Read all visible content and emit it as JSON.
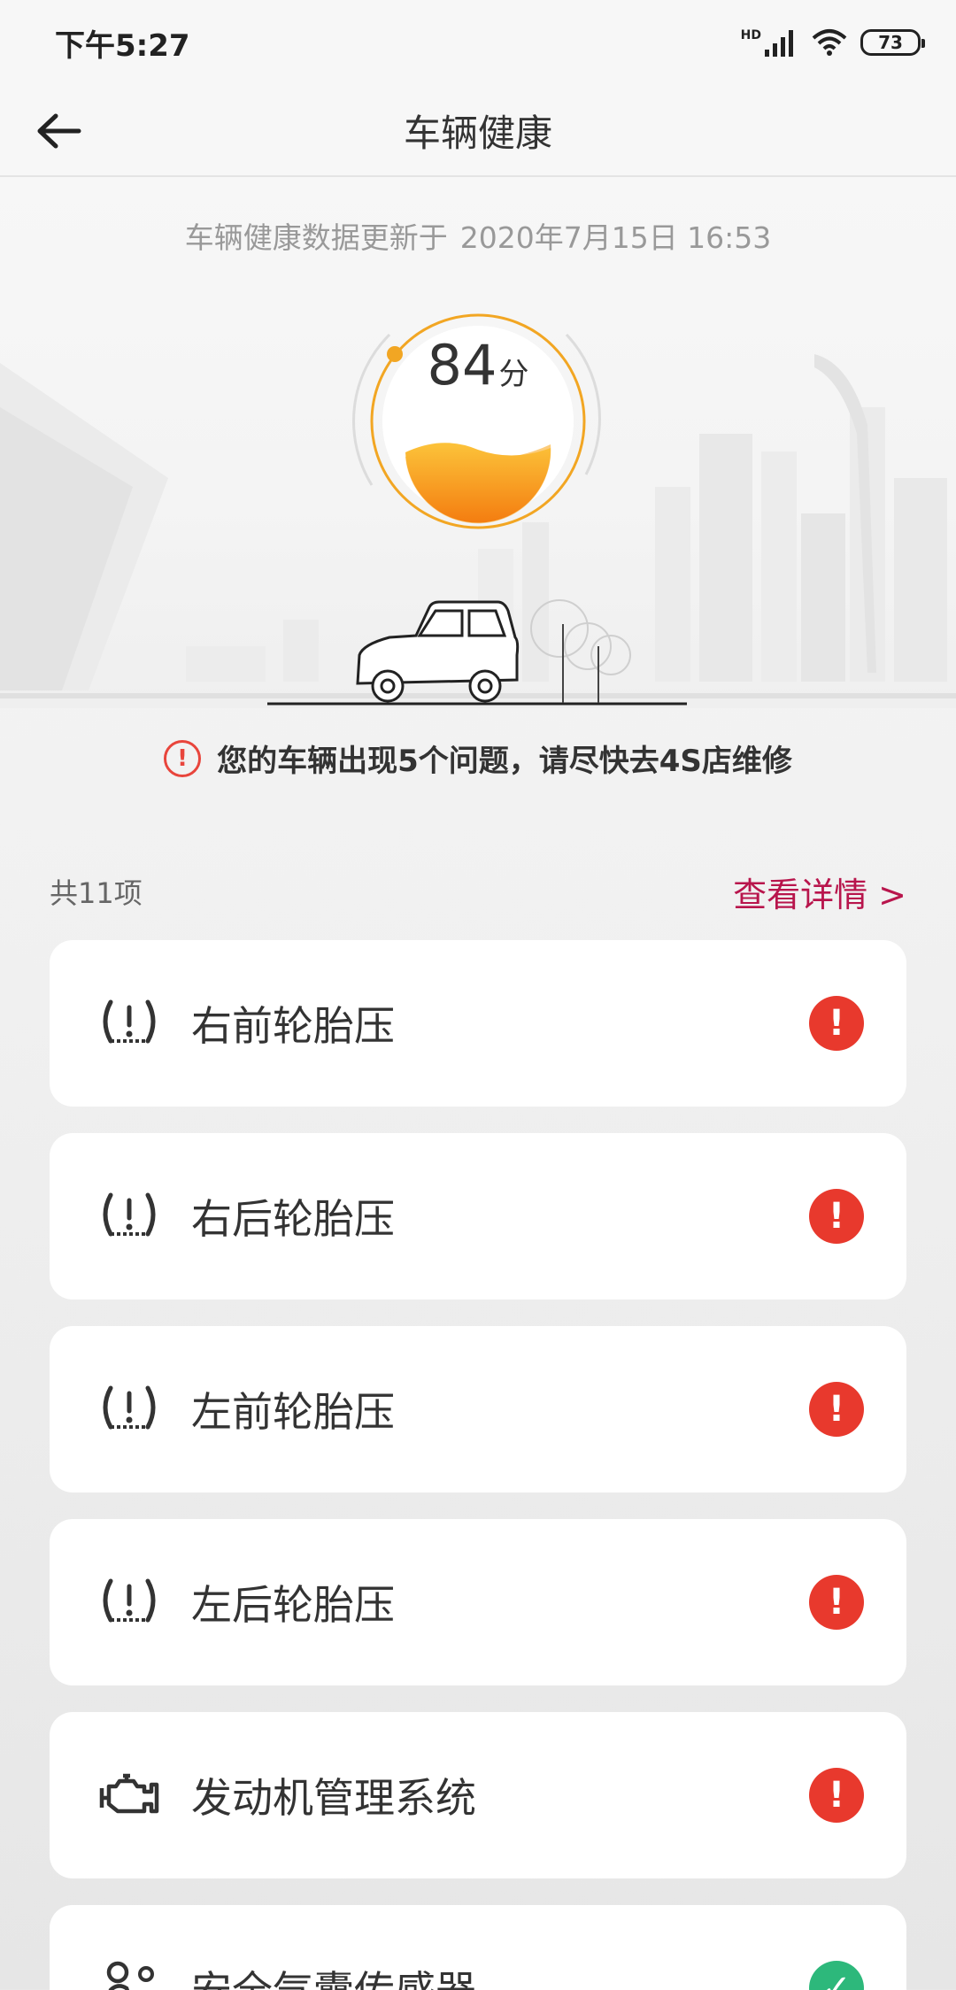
{
  "status_bar": {
    "time": "下午5:27",
    "network": "HD",
    "battery": "73"
  },
  "app_bar": {
    "title": "车辆健康",
    "back_icon": "arrow-left-icon"
  },
  "health": {
    "update_label": "车辆健康数据更新于",
    "update_time": "2020年7月15日 16:53",
    "score": "84",
    "score_unit": "分",
    "score_value": 84,
    "accent_color": "#f2a623"
  },
  "alert": {
    "icon": "!",
    "message": "您的车辆出现5个问题，请尽快去4S店维修",
    "color": "#e8453c"
  },
  "list": {
    "count_label": "共11项",
    "details_link": "查看详情 >",
    "items": [
      {
        "label": "右前轮胎压",
        "icon": "tire-pressure-icon",
        "status": "error",
        "status_glyph": "!"
      },
      {
        "label": "右后轮胎压",
        "icon": "tire-pressure-icon",
        "status": "error",
        "status_glyph": "!"
      },
      {
        "label": "左前轮胎压",
        "icon": "tire-pressure-icon",
        "status": "error",
        "status_glyph": "!"
      },
      {
        "label": "左后轮胎压",
        "icon": "tire-pressure-icon",
        "status": "error",
        "status_glyph": "!"
      },
      {
        "label": "发动机管理系统",
        "icon": "engine-icon",
        "status": "error",
        "status_glyph": "!"
      },
      {
        "label": "安全气囊传感器",
        "icon": "airbag-icon",
        "status": "ok",
        "status_glyph": "✓"
      }
    ]
  },
  "colors": {
    "error": "#e8392d",
    "ok": "#2db87b",
    "link": "#b8154c"
  }
}
